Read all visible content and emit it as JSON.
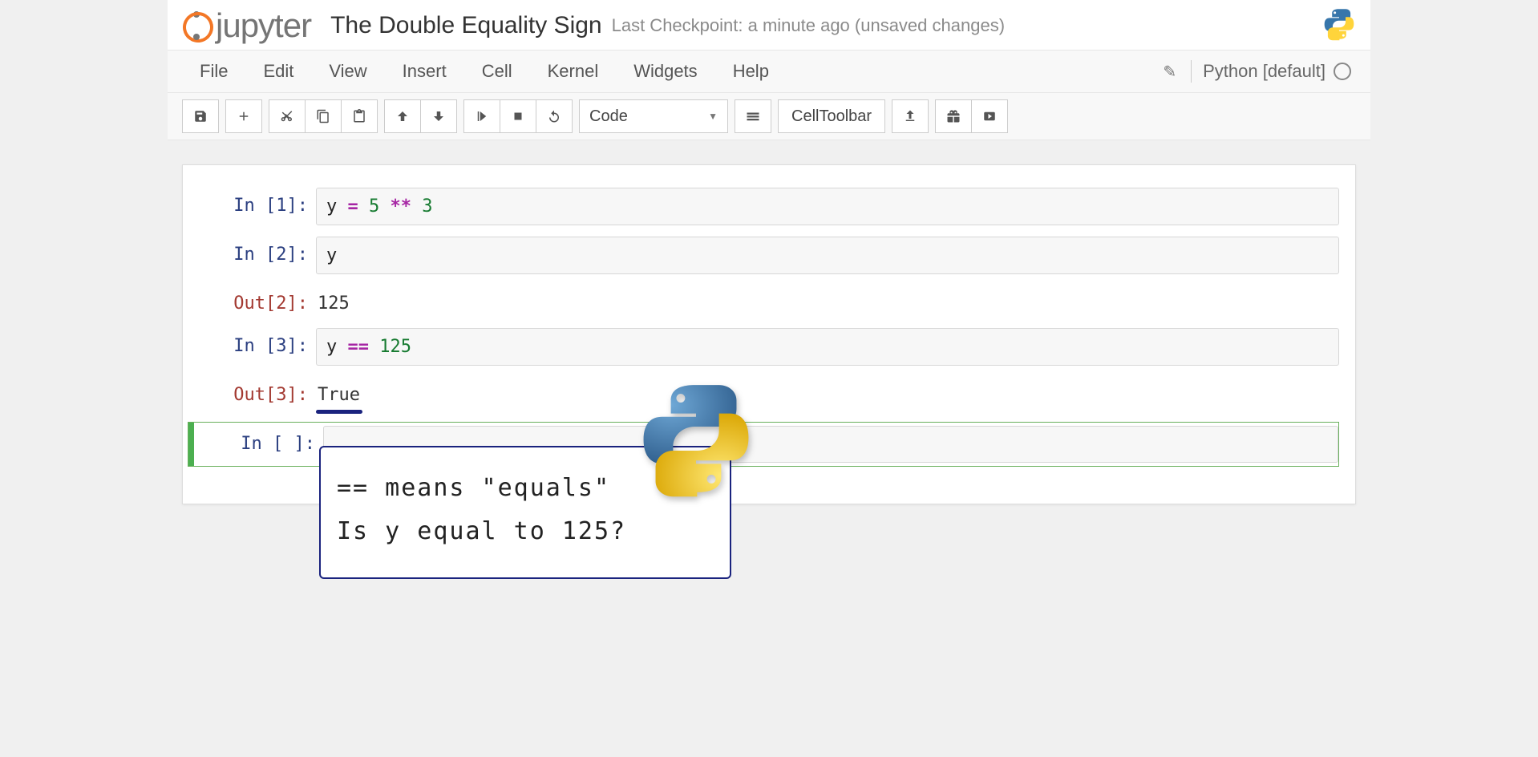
{
  "header": {
    "logo_text": "jupyter",
    "title": "The Double Equality Sign",
    "checkpoint": "Last Checkpoint: a minute ago (unsaved changes)"
  },
  "menu": {
    "items": [
      "File",
      "Edit",
      "View",
      "Insert",
      "Cell",
      "Kernel",
      "Widgets",
      "Help"
    ],
    "kernel_name": "Python [default]"
  },
  "toolbar": {
    "celltype": "Code",
    "celltoolbar_label": "CellToolbar"
  },
  "cells": [
    {
      "in_prompt": "In [1]:",
      "code_tokens": [
        {
          "t": "y ",
          "c": "var"
        },
        {
          "t": "=",
          "c": "op"
        },
        {
          "t": " ",
          "c": "var"
        },
        {
          "t": "5",
          "c": "num"
        },
        {
          "t": " ",
          "c": "var"
        },
        {
          "t": "**",
          "c": "op"
        },
        {
          "t": " ",
          "c": "var"
        },
        {
          "t": "3",
          "c": "num"
        }
      ],
      "out_prompt": null,
      "output": null
    },
    {
      "in_prompt": "In [2]:",
      "code_tokens": [
        {
          "t": "y",
          "c": "var"
        }
      ],
      "out_prompt": "Out[2]:",
      "output": "125"
    },
    {
      "in_prompt": "In [3]:",
      "code_tokens": [
        {
          "t": "y ",
          "c": "var"
        },
        {
          "t": "==",
          "c": "op"
        },
        {
          "t": " ",
          "c": "var"
        },
        {
          "t": "125",
          "c": "num"
        }
      ],
      "out_prompt": "Out[3]:",
      "output": "True",
      "output_underlined": true
    },
    {
      "in_prompt": "In [ ]:",
      "code_tokens": [],
      "out_prompt": null,
      "output": null,
      "selected": true
    }
  ],
  "callout": {
    "line1": "== means \"equals\"",
    "line2": "Is y equal to 125?"
  }
}
